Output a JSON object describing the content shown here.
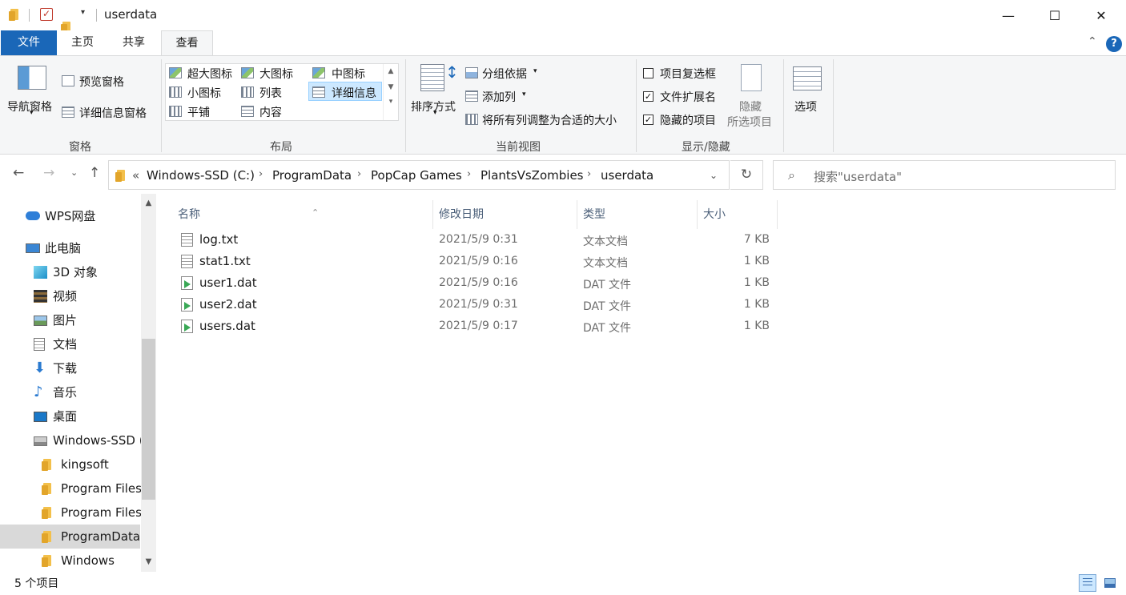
{
  "window": {
    "title": "userdata",
    "minimize": "—",
    "maximize": "☐",
    "close": "✕"
  },
  "ribbon_tabs": {
    "file": "文件",
    "home": "主页",
    "share": "共享",
    "view": "查看"
  },
  "ribbon": {
    "panes": {
      "group_label": "窗格",
      "nav_pane": "导航窗格",
      "preview_pane": "预览窗格",
      "details_pane": "详细信息窗格"
    },
    "layout": {
      "group_label": "布局",
      "extra_large": "超大图标",
      "large": "大图标",
      "medium": "中图标",
      "small": "小图标",
      "list": "列表",
      "details": "详细信息",
      "tiles": "平铺",
      "content": "内容"
    },
    "current_view": {
      "group_label": "当前视图",
      "sort_by": "排序方式",
      "group_by": "分组依据",
      "add_columns": "添加列",
      "size_all_columns": "将所有列调整为合适的大小"
    },
    "show_hide": {
      "group_label": "显示/隐藏",
      "item_checkboxes": "项目复选框",
      "item_checkboxes_checked": false,
      "file_extensions": "文件扩展名",
      "file_extensions_checked": true,
      "hidden_items": "隐藏的项目",
      "hidden_items_checked": true,
      "hide_selected_1": "隐藏",
      "hide_selected_2": "所选项目"
    },
    "options": "选项"
  },
  "address": {
    "overflow": "«",
    "crumbs": [
      "Windows-SSD (C:)",
      "ProgramData",
      "PopCap Games",
      "PlantsVsZombies",
      "userdata"
    ],
    "separator": "›"
  },
  "search": {
    "placeholder": "搜索\"userdata\""
  },
  "nav": {
    "items": [
      {
        "label": "WPS网盘",
        "icon": "cloud-icon"
      },
      {
        "label": "此电脑",
        "icon": "computer-icon"
      },
      {
        "label": "3D 对象",
        "icon": "cube-icon"
      },
      {
        "label": "视频",
        "icon": "film-icon"
      },
      {
        "label": "图片",
        "icon": "picture-icon"
      },
      {
        "label": "文档",
        "icon": "document-icon"
      },
      {
        "label": "下载",
        "icon": "download-icon"
      },
      {
        "label": "音乐",
        "icon": "music-icon"
      },
      {
        "label": "桌面",
        "icon": "desktop-icon"
      },
      {
        "label": "Windows-SSD (",
        "icon": "drive-icon"
      },
      {
        "label": "kingsoft",
        "icon": "folder-icon"
      },
      {
        "label": "Program Files",
        "icon": "folder-icon"
      },
      {
        "label": "Program Files",
        "icon": "folder-icon"
      },
      {
        "label": "ProgramData",
        "icon": "folder-icon"
      },
      {
        "label": "Windows",
        "icon": "folder-icon"
      }
    ],
    "selected": "ProgramData"
  },
  "columns": {
    "name": "名称",
    "date": "修改日期",
    "type": "类型",
    "size": "大小"
  },
  "files": [
    {
      "name": "log.txt",
      "date": "2021/5/9 0:31",
      "type": "文本文档",
      "size": "7 KB",
      "kind": "txt"
    },
    {
      "name": "stat1.txt",
      "date": "2021/5/9 0:16",
      "type": "文本文档",
      "size": "1 KB",
      "kind": "txt"
    },
    {
      "name": "user1.dat",
      "date": "2021/5/9 0:16",
      "type": "DAT 文件",
      "size": "1 KB",
      "kind": "dat"
    },
    {
      "name": "user2.dat",
      "date": "2021/5/9 0:31",
      "type": "DAT 文件",
      "size": "1 KB",
      "kind": "dat"
    },
    {
      "name": "users.dat",
      "date": "2021/5/9 0:17",
      "type": "DAT 文件",
      "size": "1 KB",
      "kind": "dat"
    }
  ],
  "status": {
    "item_count": "5 个项目"
  },
  "colors": {
    "accent": "#1a67b8",
    "selection": "#cce8ff",
    "folder": "#f3c04b"
  }
}
